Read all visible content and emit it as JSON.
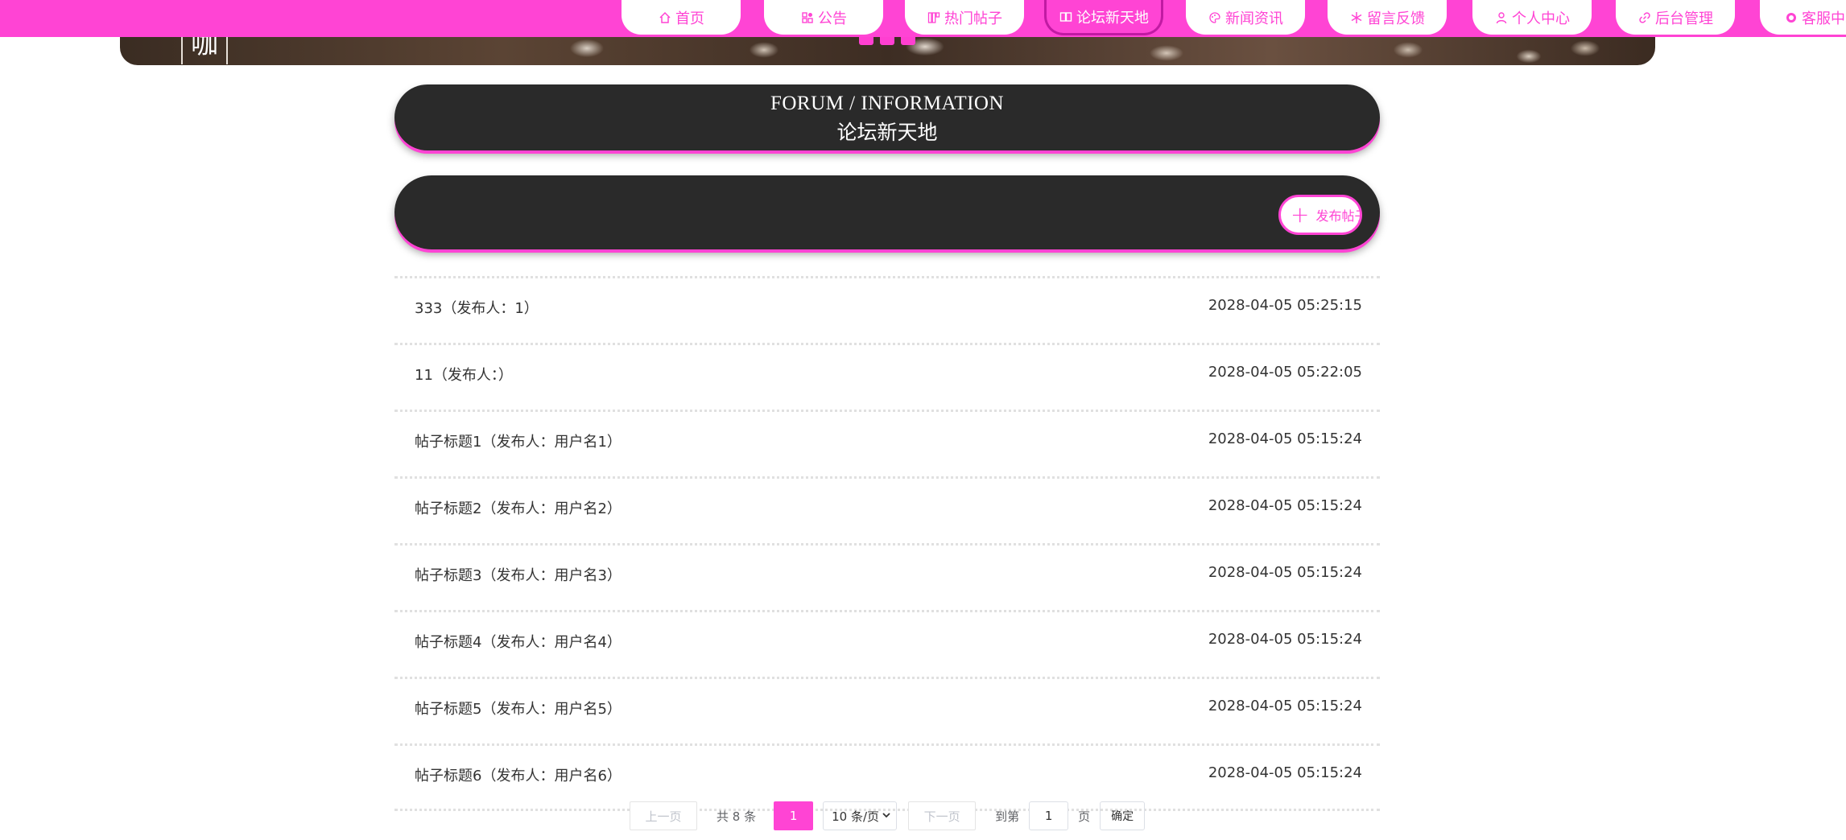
{
  "banner": {
    "char": "咖"
  },
  "nav": {
    "items": [
      {
        "label": "首页",
        "icon": "home-icon"
      },
      {
        "label": "公告",
        "icon": "grid-icon"
      },
      {
        "label": "热门帖子",
        "icon": "apps-icon"
      },
      {
        "label": "论坛新天地",
        "icon": "chat-icon",
        "active": true
      },
      {
        "label": "新闻资讯",
        "icon": "palette-icon"
      },
      {
        "label": "留言反馈",
        "icon": "snowflake-icon"
      },
      {
        "label": "个人中心",
        "icon": "user-icon"
      },
      {
        "label": "后台管理",
        "icon": "link-icon"
      },
      {
        "label": "客服中心",
        "icon": "service-icon"
      }
    ]
  },
  "header": {
    "title_en": "FORUM / INFORMATION",
    "title_cn": "论坛新天地"
  },
  "actions": {
    "publish_label": "发布帖子"
  },
  "posts": [
    {
      "title": "333（发布人：1）",
      "date": "2028-04-05 05:25:15"
    },
    {
      "title": "11（发布人：）",
      "date": "2028-04-05 05:22:05"
    },
    {
      "title": "帖子标题1（发布人：用户名1）",
      "date": "2028-04-05 05:15:24"
    },
    {
      "title": "帖子标题2（发布人：用户名2）",
      "date": "2028-04-05 05:15:24"
    },
    {
      "title": "帖子标题3（发布人：用户名3）",
      "date": "2028-04-05 05:15:24"
    },
    {
      "title": "帖子标题4（发布人：用户名4）",
      "date": "2028-04-05 05:15:24"
    },
    {
      "title": "帖子标题5（发布人：用户名5）",
      "date": "2028-04-05 05:15:24"
    },
    {
      "title": "帖子标题6（发布人：用户名6）",
      "date": "2028-04-05 05:15:24"
    }
  ],
  "pagination": {
    "prev_label": "上一页",
    "total_label": "共 8 条",
    "current_page": "1",
    "page_size_label": "10 条/页",
    "next_label": "下一页",
    "goto_label": "到第",
    "goto_value": "1",
    "page_label": "页",
    "confirm_label": "确定"
  },
  "colors": {
    "accent": "#ff44d4",
    "panel": "#2a2a2a"
  }
}
